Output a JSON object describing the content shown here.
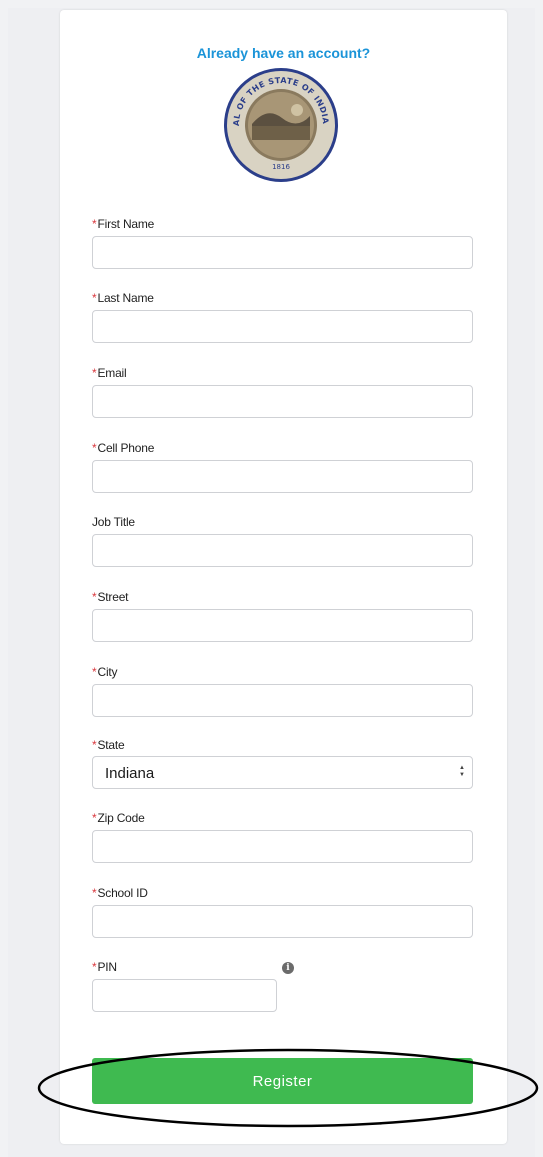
{
  "header": {
    "login_link": "Already have an account?",
    "seal": {
      "icon": "indiana-state-seal",
      "ring_text": "SEAL OF THE STATE OF INDIANA",
      "year": "1816"
    }
  },
  "form": {
    "required_marker": "*",
    "fields": [
      {
        "label": "First Name",
        "required": true,
        "value": "",
        "placeholder": ""
      },
      {
        "label": "Last Name",
        "required": true,
        "value": "",
        "placeholder": ""
      },
      {
        "label": "Email",
        "required": true,
        "value": "",
        "placeholder": ""
      },
      {
        "label": "Cell Phone",
        "required": true,
        "value": "",
        "placeholder": ""
      },
      {
        "label": "Job Title",
        "required": false,
        "value": "",
        "placeholder": ""
      },
      {
        "label": "Street",
        "required": true,
        "value": "",
        "placeholder": ""
      },
      {
        "label": "City",
        "required": true,
        "value": "",
        "placeholder": ""
      },
      {
        "label": "State",
        "required": true,
        "value": "Indiana"
      },
      {
        "label": "Zip Code",
        "required": true,
        "value": "",
        "placeholder": ""
      },
      {
        "label": "School ID",
        "required": true,
        "value": "",
        "placeholder": ""
      },
      {
        "label": "PIN",
        "required": true,
        "value": "",
        "placeholder": ""
      }
    ],
    "info_icon": "info-icon",
    "submit_label": "Register"
  },
  "colors": {
    "link": "#1b94d8",
    "required": "#d9383e",
    "button": "#3fba50",
    "button_text": "#ffffff"
  }
}
